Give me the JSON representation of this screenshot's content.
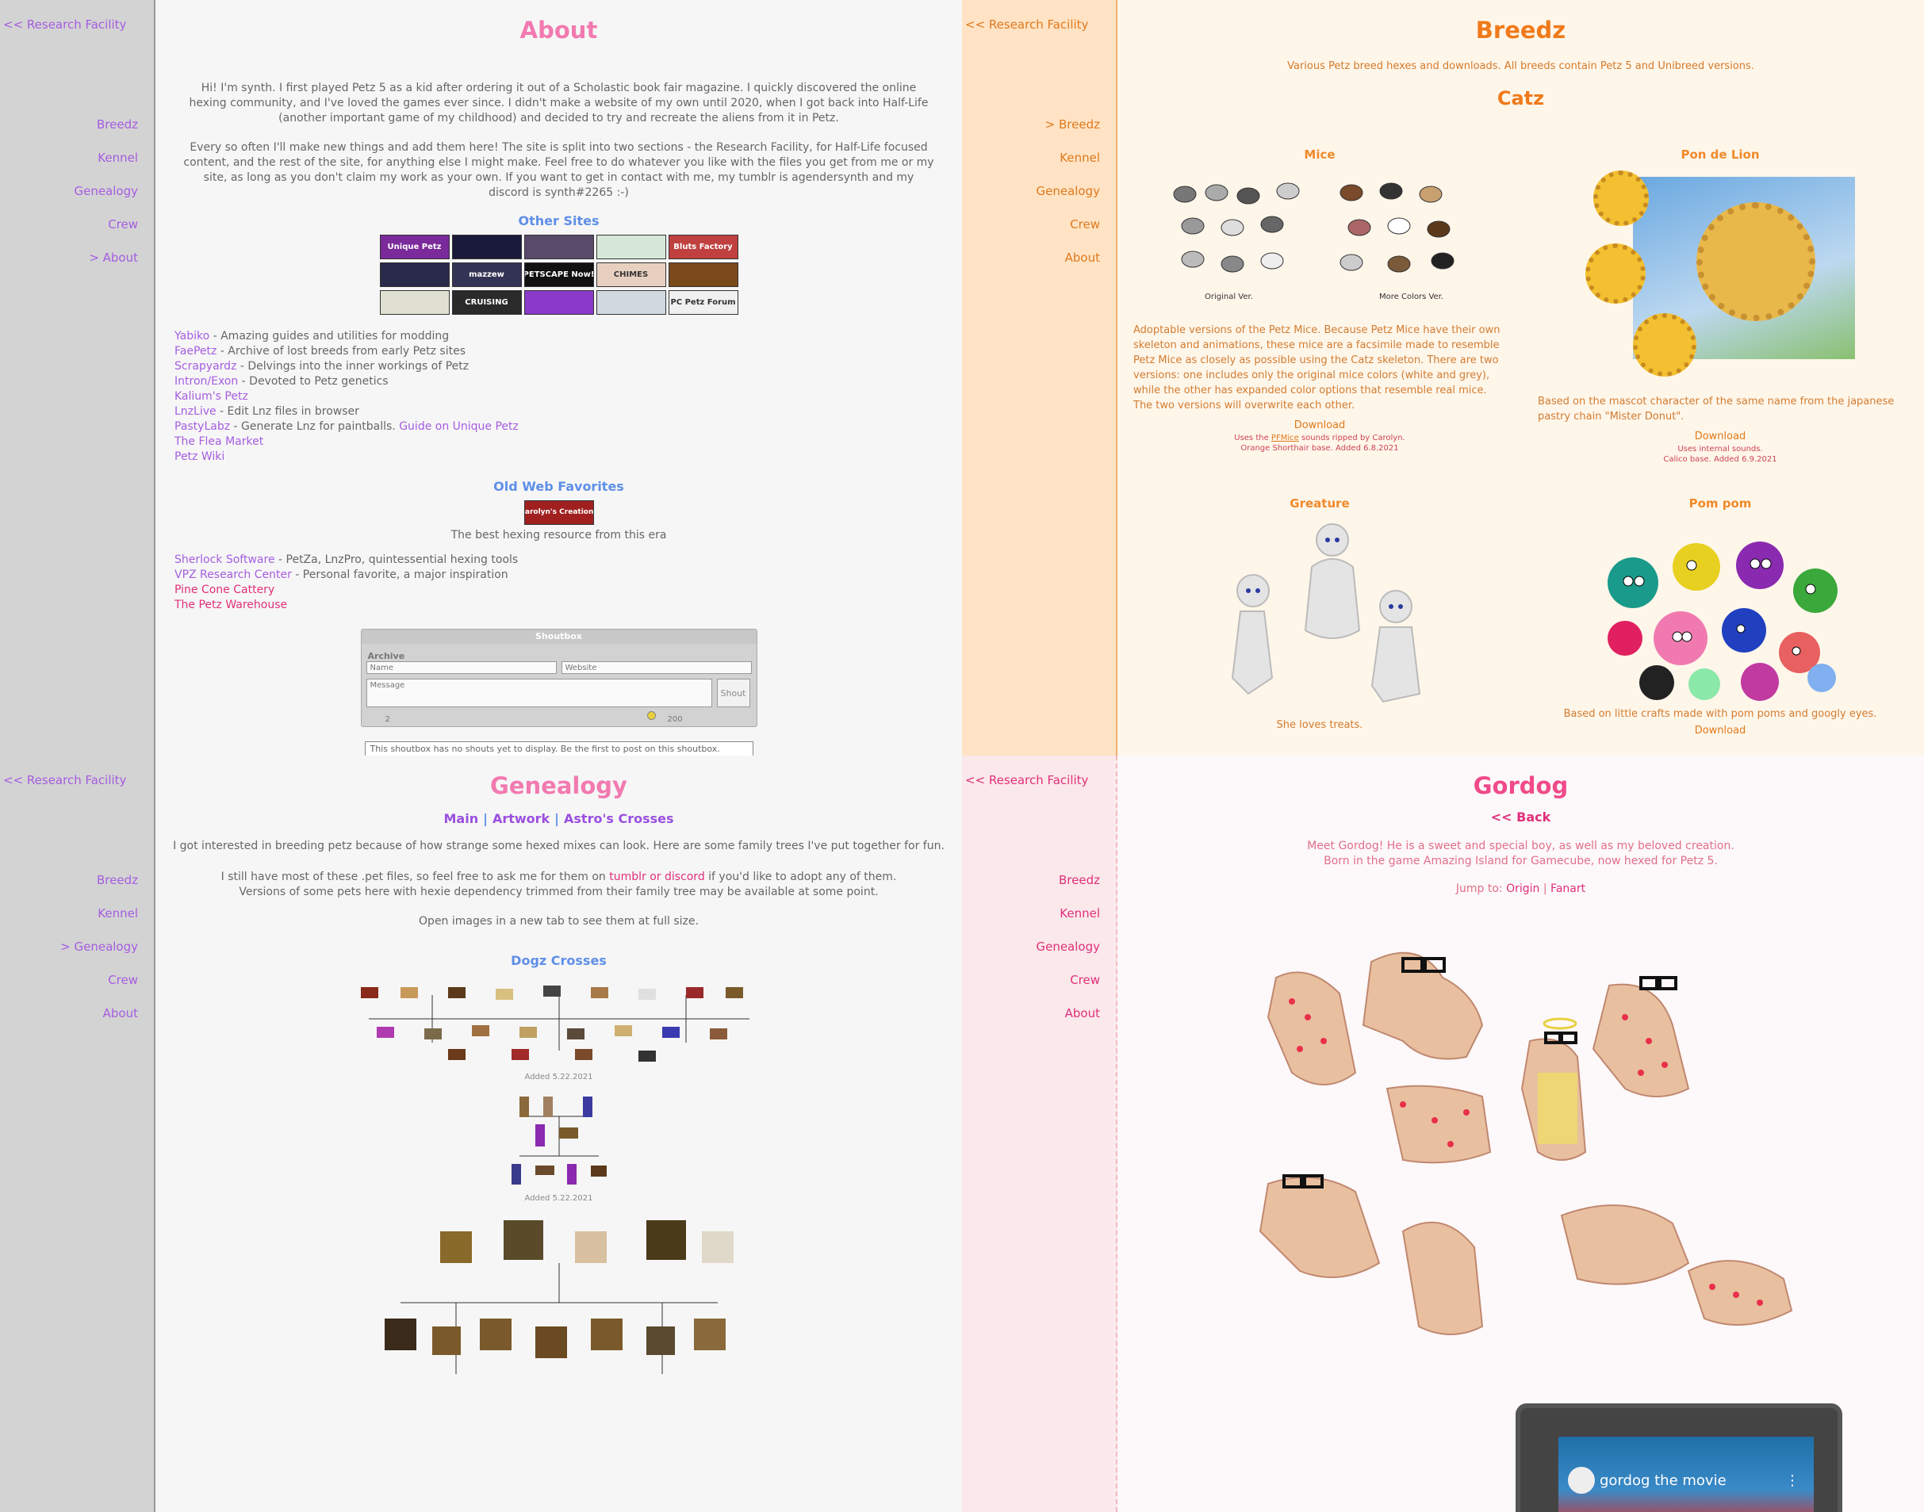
{
  "about": {
    "back_link": "<< Research Facility",
    "nav": [
      "Breedz",
      "Kennel",
      "Genealogy",
      "Crew",
      "> About"
    ],
    "title": "About",
    "para1": "Hi! I'm synth. I first played Petz 5 as a kid after ordering it out of a Scholastic book fair magazine. I quickly discovered the online hexing community, and I've loved the games ever since. I didn't make a website of my own until 2020, when I got back into Half-Life (another important game of my childhood) and decided to try and recreate the aliens from it in Petz.",
    "para2": "Every so often I'll make new things and add them here! The site is split into two sections - the Research Facility, for Half-Life focused content, and the rest of the site, for anything else I might make. Feel free to do whatever you like with the files you get from me or my site, as long as you don't claim my work as your own. If you want to get in contact with me, my tumblr is agendersynth and my discord is synth#2265 :-)",
    "other_sites_heading": "Other Sites",
    "buttons": [
      {
        "label": "Unique Petz",
        "color": "#7a2a9a"
      },
      {
        "label": "",
        "color": "#1a1a3a"
      },
      {
        "label": "",
        "color": "#5a4a6a"
      },
      {
        "label": "",
        "color": "#d8e8d8"
      },
      {
        "label": "Bluts Factory",
        "color": "#c04040"
      },
      {
        "label": "",
        "color": "#2a2a4a"
      },
      {
        "label": "mazzew",
        "color": "#333355"
      },
      {
        "label": "PETSCAPE Now!",
        "color": "#111111"
      },
      {
        "label": "CHIMES",
        "color": "#e8d0c0"
      },
      {
        "label": "",
        "color": "#7a4a1a"
      },
      {
        "label": "",
        "color": "#e0e0d0"
      },
      {
        "label": "CRUISING",
        "color": "#2a2a2a"
      },
      {
        "label": "",
        "color": "#8a3ac8"
      },
      {
        "label": "",
        "color": "#d0d8e0"
      },
      {
        "label": "PC Petz Forum",
        "color": "#f0f0f0"
      }
    ],
    "links": [
      {
        "name": "Yabiko",
        "desc": " - Amazing guides and utilities for modding",
        "color": "#a55de0"
      },
      {
        "name": "FaePetz",
        "desc": " - Archive of lost breeds from early Petz sites",
        "color": "#a55de0"
      },
      {
        "name": "Scrapyardz",
        "desc": " - Delvings into the inner workings of Petz",
        "color": "#a55de0"
      },
      {
        "name": "Intron/Exon",
        "desc": " - Devoted to Petz genetics",
        "color": "#a55de0"
      },
      {
        "name": "Kalium's Petz",
        "desc": "",
        "color": "#a55de0"
      },
      {
        "name": "LnzLive",
        "desc": " - Edit Lnz files in browser",
        "color": "#a55de0"
      },
      {
        "name": "PastyLabz",
        "desc": " - Generate Lnz for paintballs. ",
        "color": "#a55de0",
        "extra": "Guide on Unique Petz"
      },
      {
        "name": "The Flea Market",
        "desc": "",
        "color": "#a55de0"
      },
      {
        "name": "Petz Wiki",
        "desc": "",
        "color": "#a55de0"
      }
    ],
    "old_web_heading": "Old Web Favorites",
    "carolyn_button": "Carolyn's Creations",
    "carolyn_caption": "The best hexing resource from this era",
    "old_links": [
      {
        "name": "Sherlock Software",
        "desc": " - PetZa, LnzPro, quintessential hexing tools"
      },
      {
        "name": "VPZ Research Center",
        "desc": " - Personal favorite, a major inspiration"
      },
      {
        "name": "Pine Cone Cattery",
        "desc": ""
      },
      {
        "name": "The Petz Warehouse",
        "desc": ""
      }
    ],
    "shoutbox": {
      "title": "Shoutbox",
      "archive": "Archive",
      "name_placeholder": "Name",
      "website_placeholder": "Website",
      "message_placeholder": "Message",
      "shout_label": "Shout",
      "count": "2",
      "limit": "200",
      "empty_note": "This shoutbox has no shouts yet to display. Be the first to post on this shoutbox."
    }
  },
  "breedz": {
    "back_link": "<< Research Facility",
    "nav": [
      "> Breedz",
      "Kennel",
      "Genealogy",
      "Crew",
      "About"
    ],
    "title": "Breedz",
    "intro": "Various Petz breed hexes and downloads. All breeds contain Petz 5 and Unibreed versions.",
    "category": "Catz",
    "mice": {
      "name": "Mice",
      "caption_left": "Original Ver.",
      "caption_right": "More Colors Ver.",
      "desc": "Adoptable versions of the Petz Mice. Because Petz Mice have their own skeleton and animations, these mice are a facsimile made to resemble Petz Mice as closely as possible using the Catz skeleton. There are two versions: one includes only the original mice colors (white and grey), while the other has expanded color options that resemble real mice. The two versions will overwrite each other.",
      "download": "Download",
      "note1_pre": "Uses the ",
      "note1_link": "PFMice",
      "note1_post": " sounds ripped by Carolyn.",
      "note2": "Orange Shorthair base. Added 6.8.2021"
    },
    "pon": {
      "name": "Pon de Lion",
      "desc": "Based on the mascot character of the same name from the japanese pastry chain \"Mister Donut\".",
      "download": "Download",
      "note1": "Uses internal sounds.",
      "note2": "Calico base. Added 6.9.2021"
    },
    "greature": {
      "name": "Greature",
      "caption": "She loves treats."
    },
    "pompom": {
      "name": "Pom pom",
      "desc": "Based on little crafts made with pom poms and googly eyes.",
      "download": "Download"
    }
  },
  "genealogy": {
    "back_link": "<< Research Facility",
    "nav": [
      "Breedz",
      "Kennel",
      "> Genealogy",
      "Crew",
      "About"
    ],
    "title": "Genealogy",
    "subnav": [
      "Main",
      "Artwork",
      "Astro's Crosses"
    ],
    "para1": "I got interested in breeding petz because of how strange some hexed mixes can look. Here are some family trees I've put together for fun.",
    "para2_pre": "I still have most of these .pet files, so feel free to ask me for them on ",
    "para2_link": "tumblr or discord",
    "para2_post": " if you'd like to adopt any of them.",
    "para3": "Versions of some pets here with hexie dependency trimmed from their family tree may be available at some point.",
    "para4": "Open images in a new tab to see them at full size.",
    "section": "Dogz Crosses",
    "added1": "Added 5.22.2021",
    "added2": "Added 5.22.2021"
  },
  "gordog": {
    "back_link": "<< Research Facility",
    "nav": [
      "Breedz",
      "Kennel",
      "Genealogy",
      "Crew",
      "About"
    ],
    "title": "Gordog",
    "back": "<< Back",
    "para1": "Meet Gordog! He is a sweet and special boy, as well as my beloved creation.",
    "para2": "Born in the game Amazing Island for Gamecube, now hexed for Petz 5.",
    "jump_label": "Jump to: ",
    "jump_links": [
      "Origin",
      "Fanart"
    ],
    "video_title": "gordog the movie"
  }
}
